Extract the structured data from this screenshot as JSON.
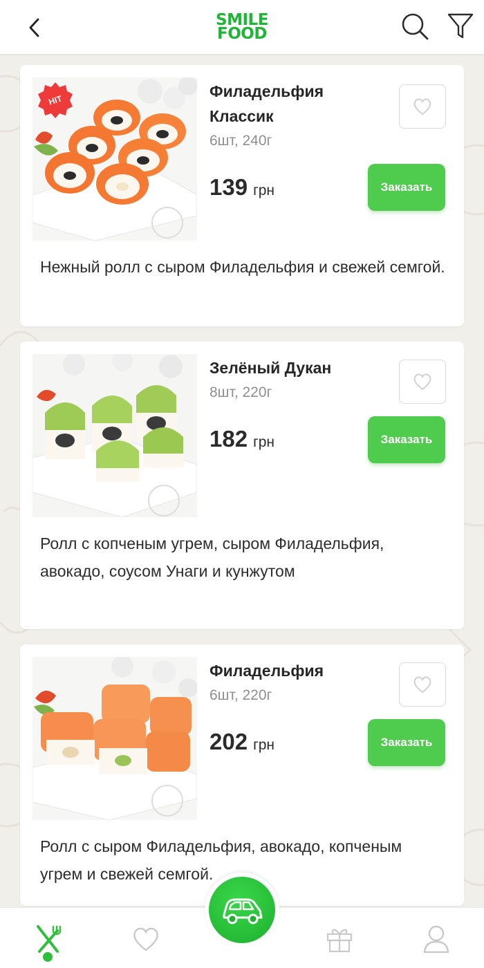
{
  "header": {
    "logo_line1": "SMILE",
    "logo_line2": "FOOD"
  },
  "colors": {
    "brand_green": "#1fb536",
    "button_green": "#4fcb4d",
    "badge_red": "#ef3a3a"
  },
  "icons": {
    "back": "chevron-left-icon",
    "search": "search-icon",
    "filter": "filter-icon",
    "favorite": "heart-icon",
    "menu": "fork-knife-icon",
    "gifts": "gift-icon",
    "profile": "user-icon",
    "delivery": "car-icon"
  },
  "products": [
    {
      "badge": "HIT",
      "title": "Филадельфия Классик",
      "weight": "6шт, 240г",
      "price": "139",
      "currency": "грн",
      "order_label": "Заказать",
      "description": "Нежный ролл с сыром Филадельфия и свежей семгой."
    },
    {
      "title": "Зелёный Дукан",
      "weight": "8шт, 220г",
      "price": "182",
      "currency": "грн",
      "order_label": "Заказать",
      "description": "Ролл с копченым угрем, сыром Филадельфия, авокадо, соусом Унаги и кунжутом"
    },
    {
      "title": "Филадельфия",
      "weight": "6шт, 220г",
      "price": "202",
      "currency": "грн",
      "order_label": "Заказать",
      "description": "Ролл с сыром Филадельфия, авокадо, копченым угрем и свежей семгой."
    }
  ]
}
